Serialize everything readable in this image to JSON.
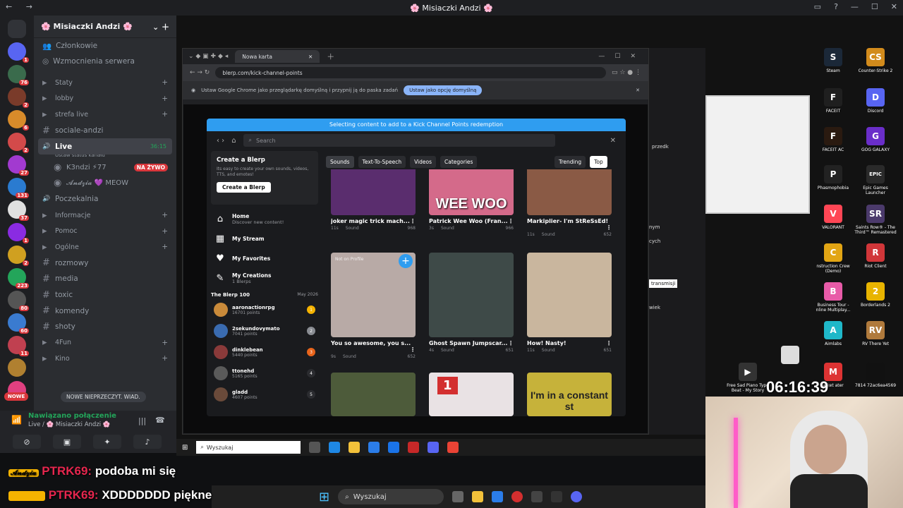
{
  "discord": {
    "window_title": "🌸 Misiaczki Andzi 🌸",
    "server_name": "🌸 Misiaczki Andzi 🌸",
    "top_items": [
      "Członkowie",
      "Wzmocnienia serwera"
    ],
    "channels": [
      {
        "type": "category",
        "label": "Staty"
      },
      {
        "type": "category",
        "label": "lobby"
      },
      {
        "type": "category",
        "label": "strefa live"
      },
      {
        "type": "text",
        "label": "sociale-andzi"
      },
      {
        "type": "voice-active",
        "label": "Live",
        "meta": "36:15",
        "status": "Ustaw status kanału"
      },
      {
        "type": "member",
        "label": "K3ndzi ⚡77",
        "badge": "NA ŻYWO"
      },
      {
        "type": "member",
        "label": "𝓐𝓷𝓭𝔃𝓲𝓪 💜 MEOW"
      },
      {
        "type": "voice",
        "label": "Poczekalnia"
      },
      {
        "type": "category",
        "label": "Informacje"
      },
      {
        "type": "category",
        "label": "Pomoc"
      },
      {
        "type": "category",
        "label": "Ogólne"
      },
      {
        "type": "text",
        "label": "rozmowy"
      },
      {
        "type": "text",
        "label": "media"
      },
      {
        "type": "text",
        "label": "toxic"
      },
      {
        "type": "text",
        "label": "komendy"
      },
      {
        "type": "text",
        "label": "shoty"
      },
      {
        "type": "category",
        "label": "4Fun"
      },
      {
        "type": "category",
        "label": "Kino"
      }
    ],
    "new_messages": "NOWE NIEPRZECZYT. WIAD.",
    "new_badge": "NOWE",
    "server_badges": [
      "1",
      "76",
      "2",
      "6",
      "2",
      "27",
      "131",
      "37",
      "1",
      "2",
      "223",
      "80",
      "60",
      "11"
    ],
    "connection": {
      "title": "Nawiązano połączenie",
      "sub": "Live / 🌸 Misiaczki Andzi 🌸"
    }
  },
  "browser": {
    "tab_title": "Nowa karta",
    "url": "blerp.com/kick-channel-points",
    "infobar_text": "Ustaw Google Chrome jako przeglądarkę domyślną i przypnij ją do paska zadań",
    "infobar_button": "Ustaw jako opcję domyślną"
  },
  "blerp": {
    "banner": "Selecting content to add to a Kick Channel Points redemption",
    "search_placeholder": "Search",
    "create_title": "Create a Blerp",
    "create_desc": "Its easy to create your own sounds, videos, TTS, and emotes!",
    "create_button": "Create a Blerp",
    "nav": [
      {
        "label": "Home",
        "sub": "Discover new content!",
        "icon": "home-icon"
      },
      {
        "label": "My Stream",
        "sub": "",
        "icon": "stream-icon"
      },
      {
        "label": "My Favorites",
        "sub": "",
        "icon": "heart-icon"
      },
      {
        "label": "My Creations",
        "sub": "1 Blerps",
        "icon": "creations-icon"
      }
    ],
    "leaderboard_title": "The Blerp 100",
    "leaderboard_date": "May 2026",
    "leaders": [
      {
        "name": "aaronactionrpg",
        "points": "16701 points",
        "rank": "1",
        "color": "#f5b300"
      },
      {
        "name": "2sekundovymato",
        "points": "7041 points",
        "rank": "2",
        "color": "#8a8d93"
      },
      {
        "name": "dinklebean",
        "points": "5440 points",
        "rank": "3",
        "color": "#e8641b"
      },
      {
        "name": "ttonehd",
        "points": "5165 points",
        "rank": "4",
        "color": "#2b2c30"
      },
      {
        "name": "gladd",
        "points": "4607 points",
        "rank": "5",
        "color": "#2b2c30"
      }
    ],
    "filters": [
      "Sounds",
      "Text-To-Speech",
      "Videos",
      "Categories"
    ],
    "sort": [
      "Trending",
      "Top"
    ],
    "cards": [
      {
        "name": "joker magic trick mach...",
        "dur": "11s",
        "type": "Sound",
        "plays": "968",
        "bg": "#5a2d6e",
        "overlay": ""
      },
      {
        "name": "Patrick Wee Woo (Fran...",
        "dur": "3s",
        "type": "Sound",
        "plays": "966",
        "bg": "#d46a8a",
        "overlay": "WEE WOO"
      },
      {
        "name": "Markiplier- I'm StReSsEd!",
        "dur": "11s",
        "type": "Sound",
        "plays": "652",
        "bg": "#8a5a45",
        "overlay": ""
      },
      {
        "name": "You so awesome, you s...",
        "dur": "9s",
        "type": "Sound",
        "plays": "652",
        "bg": "#b8aaa6",
        "overlay": "",
        "tag": "Not on Profile"
      },
      {
        "name": "Ghost Spawn Jumpscar...",
        "dur": "4s",
        "type": "Sound",
        "plays": "651",
        "bg": "#3e4a48",
        "overlay": ""
      },
      {
        "name": "How! Nasty!",
        "dur": "11s",
        "type": "Sound",
        "plays": "651",
        "bg": "#c9b69e",
        "overlay": ""
      },
      {
        "name": "",
        "dur": "",
        "type": "",
        "plays": "",
        "bg": "#4d5b3a",
        "overlay": ""
      },
      {
        "name": "",
        "dur": "",
        "type": "",
        "plays": "",
        "bg": "#e9e2e4",
        "overlay": "1"
      },
      {
        "name": "",
        "dur": "",
        "type": "",
        "plays": "",
        "bg": "#c6b23a",
        "overlay": "I'm in a constant st"
      }
    ]
  },
  "desktop_icons": [
    {
      "label": "Steam",
      "color": "#1b2838",
      "glyph": "S"
    },
    {
      "label": "Counter-Strike 2",
      "color": "#d28b1c",
      "glyph": "CS"
    },
    {
      "label": "FACEIT",
      "color": "#1f1f1f",
      "glyph": "F"
    },
    {
      "label": "Discord",
      "color": "#5865f2",
      "glyph": "D"
    },
    {
      "label": "FACEIT AC",
      "color": "#2a1a10",
      "glyph": "F"
    },
    {
      "label": "GOG GALAXY",
      "color": "#6a2ec9",
      "glyph": "G"
    },
    {
      "label": "Phasmophobia",
      "color": "#222",
      "glyph": "P"
    },
    {
      "label": "Epic Games Launcher",
      "color": "#2a2a2a",
      "glyph": "EPIC"
    },
    {
      "label": "VALORANT",
      "color": "#ff4655",
      "glyph": "V"
    },
    {
      "label": "Saints Row® - The Third™ Remastered",
      "color": "#4b3a6b",
      "glyph": "SR"
    },
    {
      "label": "nstruction Crew (Demo)",
      "color": "#e2a514",
      "glyph": "C"
    },
    {
      "label": "Riot Client",
      "color": "#d13639",
      "glyph": "R"
    },
    {
      "label": "Business Tour - nline Multiplay...",
      "color": "#e85ba8",
      "glyph": "B"
    },
    {
      "label": "Borderlands 2",
      "color": "#e8b400",
      "glyph": "2"
    },
    {
      "label": "Aimlabs",
      "color": "#1fb8c9",
      "glyph": "A"
    },
    {
      "label": "RV There Yet",
      "color": "#b07a3c",
      "glyph": "RV"
    },
    {
      "label": "Free Sad Piano Type Beat - My Story",
      "color": "#333",
      "glyph": "▶"
    },
    {
      "label": "",
      "color": "#ddd",
      "glyph": ""
    },
    {
      "label": "arket ater",
      "color": "#d33",
      "glyph": "M"
    },
    {
      "label": "7814 72ac6ea4569",
      "color": "#111",
      "glyph": ""
    }
  ],
  "obs": {
    "tooltip": "transmisji",
    "labels": [
      "przedk",
      "nym",
      "cych",
      "wiek"
    ]
  },
  "timer": "06:16:39",
  "taskbar_inner": {
    "search": "Wyszukaj"
  },
  "taskbar_outer": {
    "search": "Wyszukaj"
  },
  "chat": [
    {
      "user": "PTRK69:",
      "msg": "podoba mi się"
    },
    {
      "user": "PTRK69:",
      "msg": "XDDDDDDD piękne"
    }
  ],
  "chat_badge": "𝓐𝓷𝓭𝔃𝓲𝓪"
}
